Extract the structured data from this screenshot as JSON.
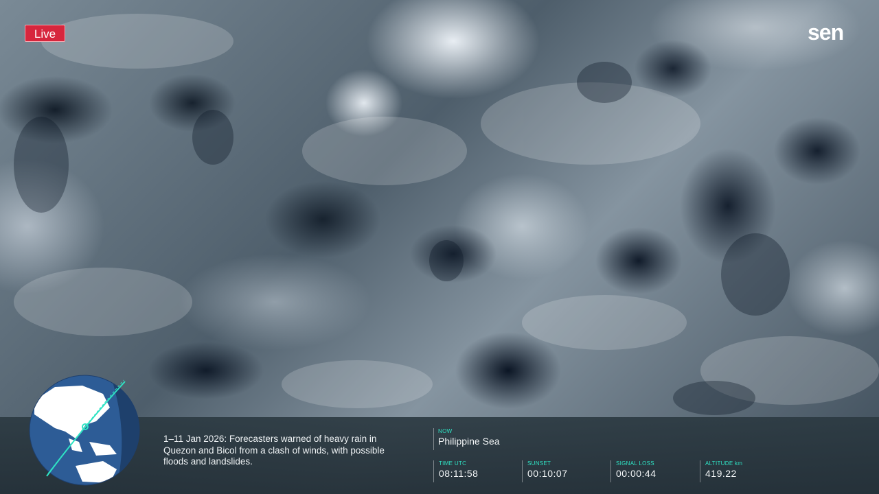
{
  "live_badge": "Live",
  "brand": "sen",
  "headline": "1–11 Jan 2026: Forecasters warned of heavy rain in Quezon and Bicol from a clash of winds, with possible floods and landslides.",
  "now": {
    "label": "NOW",
    "value": "Philippine Sea"
  },
  "stats": [
    {
      "label": "TIME UTC",
      "value": "08:11:58"
    },
    {
      "label": "SUNSET",
      "value": "00:10:07"
    },
    {
      "label": "SIGNAL LOSS",
      "value": "00:00:44"
    },
    {
      "label": "ALTITUDE km",
      "value": "419.22"
    }
  ],
  "colors": {
    "live_red": "#d7263d",
    "accent_teal": "#2fe3c4",
    "bar_bg": "#2c3a42"
  }
}
